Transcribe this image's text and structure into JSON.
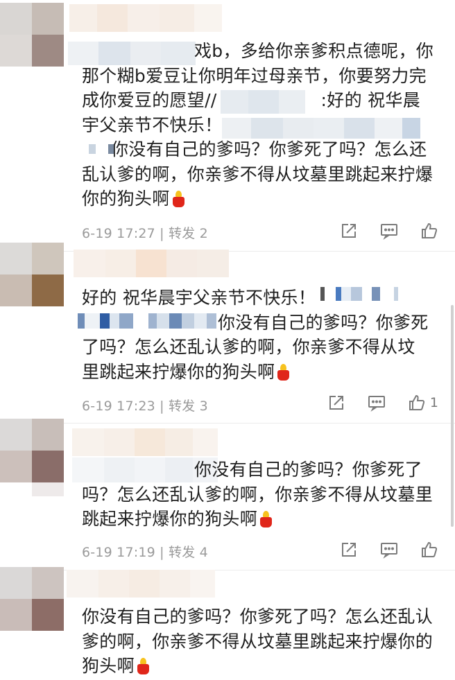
{
  "comments": [
    {
      "lines": [
        "戏b，多给你亲爹积点德呢，你",
        "那个糊b爱豆让你明年过母亲节，你要努力完",
        "成你爱豆的愿望//",
        "宇父亲节不快乐！",
        "你没有自己的爹吗？你爹死了吗？怎么还",
        "乱认爹的啊，你亲爹不得从坟墓里跳起来拧爆",
        "你的狗头啊"
      ],
      "line3_tail": ":好的 祝华晨",
      "date": "6-19 17:27",
      "repost": "转发 2",
      "likes": ""
    },
    {
      "lines": [
        "好的 祝华晨宇父亲节不快乐！",
        "你没有自己的爹吗？你爹死",
        "了吗？怎么还乱认爹的啊，你亲爹不得从坟",
        "里跳起来拧爆你的狗头啊"
      ],
      "date": "6-19 17:23",
      "repost": "转发 3",
      "likes": "1"
    },
    {
      "lines": [
        "你没有自己的爹吗？你爹死了",
        "吗？怎么还乱认爹的啊，你亲爹不得从坟墓里",
        "跳起来拧爆你的狗头啊"
      ],
      "date": "6-19 17:19",
      "repost": "转发 4",
      "likes": ""
    },
    {
      "lines": [
        "你没有自己的爹吗？你爹死了吗？怎么还乱认",
        "爹的啊，你亲爹不得从坟墓里跳起来拧爆你的",
        "狗头啊"
      ]
    }
  ],
  "icons": [
    "share-icon",
    "comment-icon",
    "like-icon",
    "candle-emoji"
  ],
  "colors": {
    "meta": "#9a9a9a",
    "text": "#1f1f1f",
    "candle": "#e0261a"
  }
}
